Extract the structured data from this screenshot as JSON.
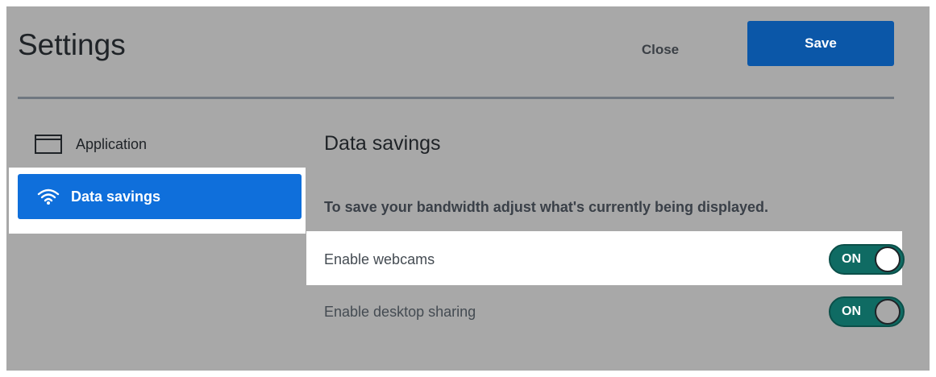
{
  "header": {
    "title": "Settings",
    "close_label": "Close",
    "save_label": "Save"
  },
  "sidebar": {
    "items": [
      {
        "label": "Application",
        "icon": "application-window-icon"
      },
      {
        "label": "Data savings",
        "icon": "wifi-icon",
        "selected": true
      }
    ]
  },
  "content": {
    "section_title": "Data savings",
    "description": "To save your bandwidth adjust what's currently being displayed.",
    "settings": [
      {
        "label": "Enable webcams",
        "toggle_state": "ON"
      },
      {
        "label": "Enable desktop sharing",
        "toggle_state": "ON"
      }
    ]
  },
  "colors": {
    "accent_blue": "#0f6fdb",
    "save_button_blue": "#0b57a8",
    "toggle_on_green": "#0f6b63",
    "backdrop_gray": "#a8a8a8"
  }
}
